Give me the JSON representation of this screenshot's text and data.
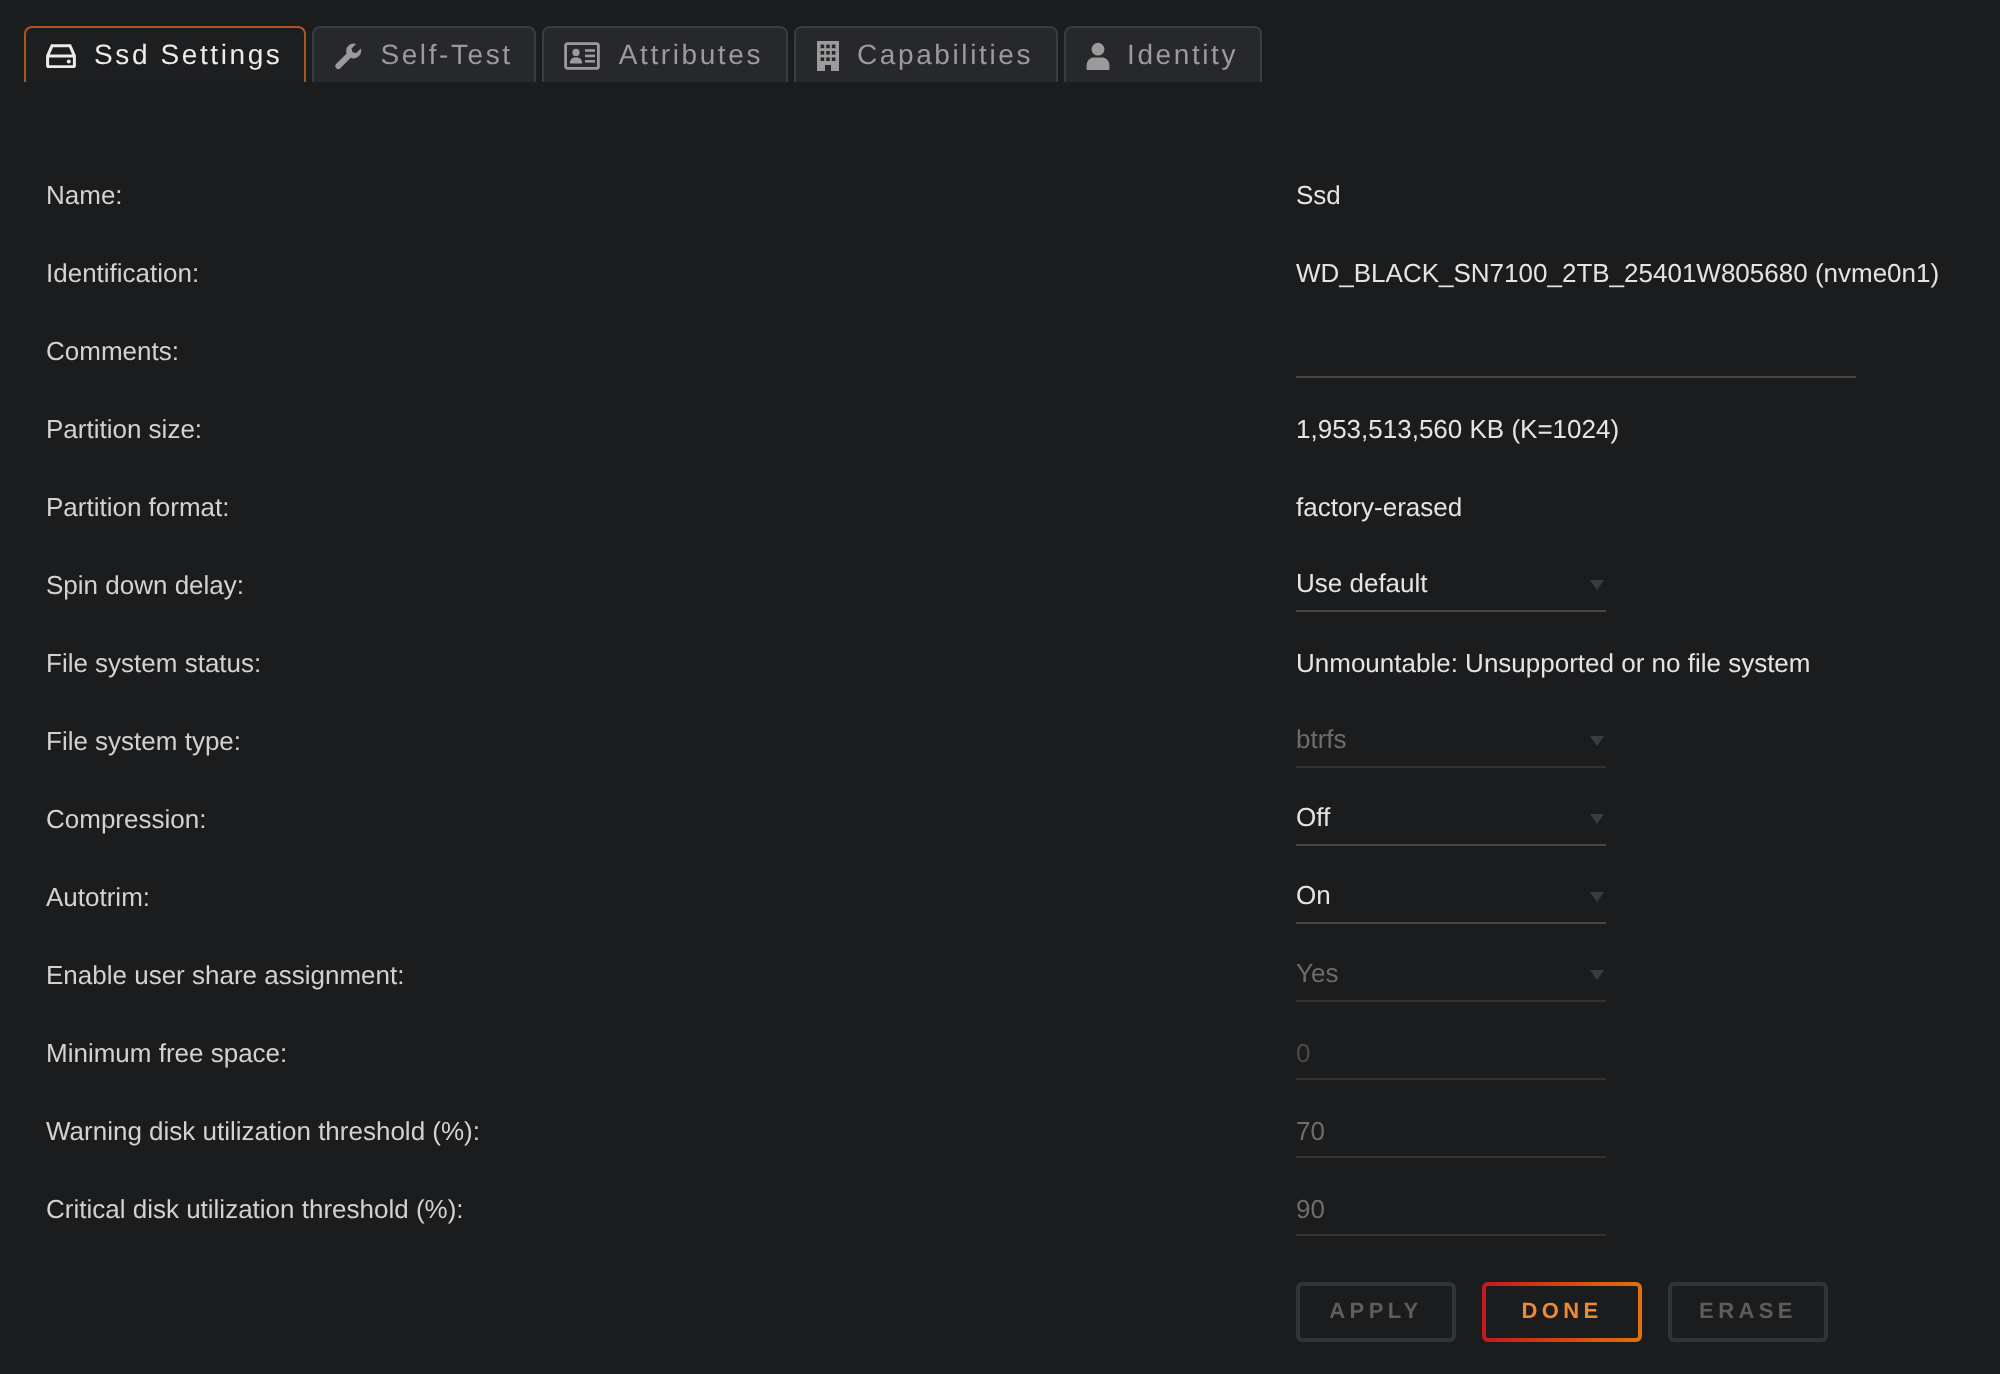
{
  "tabs": [
    {
      "label": "Ssd Settings",
      "selected": true
    },
    {
      "label": "Self-Test",
      "selected": false
    },
    {
      "label": "Attributes",
      "selected": false
    },
    {
      "label": "Capabilities",
      "selected": false
    },
    {
      "label": "Identity",
      "selected": false
    }
  ],
  "settings": [
    {
      "label": "Name:",
      "kind": "text",
      "value": "Ssd",
      "disabled": false
    },
    {
      "label": "Identification:",
      "kind": "text",
      "value": "WD_BLACK_SN7100_2TB_25401W805680 (nvme0n1)",
      "disabled": false
    },
    {
      "label": "Comments:",
      "kind": "text_input",
      "disabled": false
    },
    {
      "label": "Partition size:",
      "kind": "text",
      "value": "1,953,513,560 KB (K=1024)",
      "disabled": false
    },
    {
      "label": "Partition format:",
      "kind": "text",
      "value": "factory-erased",
      "disabled": false
    },
    {
      "label": "Spin down delay:",
      "kind": "select",
      "value": "Use default",
      "disabled": false
    },
    {
      "label": "File system status:",
      "kind": "text",
      "value": "Unmountable: Unsupported or no file system",
      "disabled": false
    },
    {
      "label": "File system type:",
      "kind": "select",
      "value": "btrfs",
      "disabled": true
    },
    {
      "label": "Compression:",
      "kind": "select",
      "value": "Off",
      "disabled": false
    },
    {
      "label": "Autotrim:",
      "kind": "select",
      "value": "On",
      "disabled": false
    },
    {
      "label": "Enable user share assignment:",
      "kind": "select",
      "value": "Yes",
      "disabled": true
    },
    {
      "label": "Minimum free space:",
      "kind": "number_input",
      "placeholder": "0",
      "disabled": true
    },
    {
      "label": "Warning disk utilization threshold (%):",
      "kind": "number_input",
      "value": "70",
      "disabled": true
    },
    {
      "label": "Critical disk utilization threshold (%):",
      "kind": "number_input",
      "value": "90",
      "disabled": true
    }
  ],
  "buttons": [
    {
      "label": "APPLY",
      "disabled": true
    },
    {
      "label": "DONE",
      "disabled": false
    },
    {
      "label": "ERASE",
      "disabled": true
    }
  ]
}
